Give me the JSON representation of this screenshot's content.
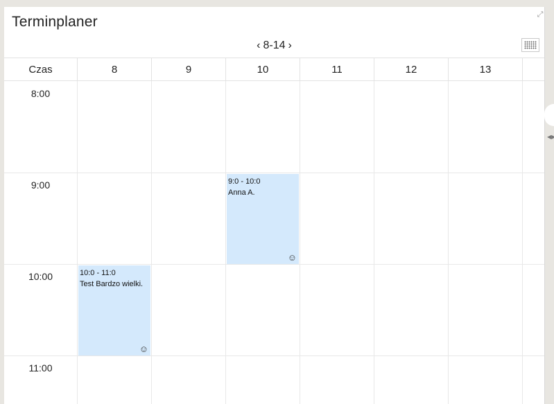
{
  "window": {
    "title": "Terminplaner"
  },
  "nav": {
    "prev": "‹",
    "range": "8-14",
    "next": "›"
  },
  "calendar": {
    "time_header": "Czas",
    "days": [
      "8",
      "9",
      "10",
      "11",
      "12",
      "13"
    ],
    "hours": [
      "8:00",
      "9:00",
      "10:00",
      "11:00"
    ],
    "events": [
      {
        "time": "9:0 - 10:0",
        "title": "Anna A.",
        "day": "10",
        "start_hour": "9:00",
        "icon": "smiley-icon"
      },
      {
        "time": "10:0 - 11:0",
        "title": "Test Bardzo wielki.",
        "day": "8",
        "start_hour": "10:00",
        "icon": "smiley-icon"
      }
    ]
  },
  "colors": {
    "event_bg": "#d4e9fc",
    "grid_line": "#e8e8e8",
    "background": "#e8e6e1"
  }
}
